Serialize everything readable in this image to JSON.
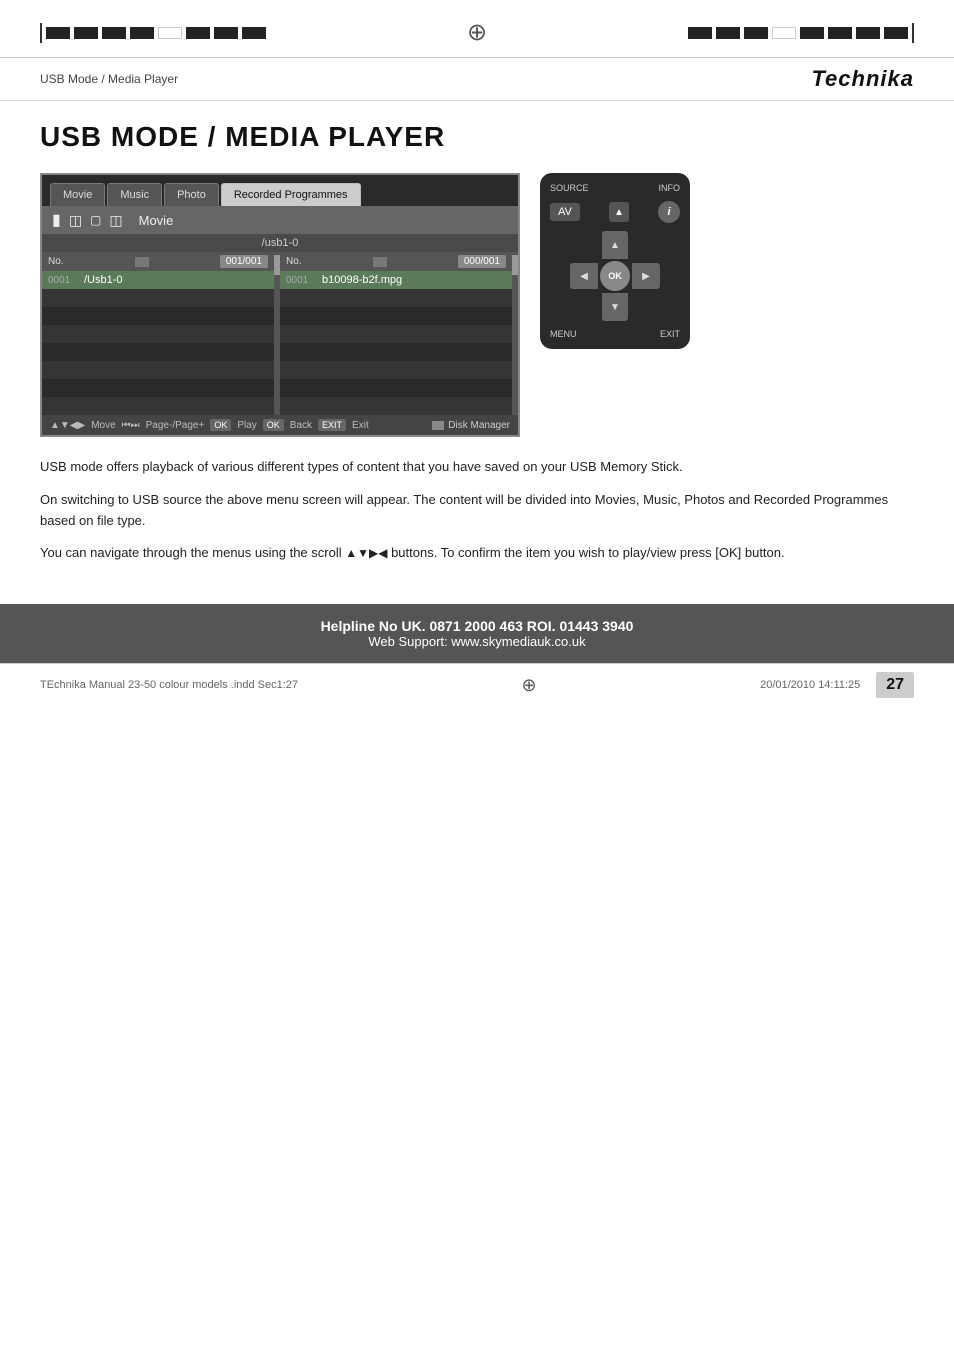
{
  "brand": "Technika",
  "header": {
    "subtitle": "USB Mode / Media Player"
  },
  "page_title": "USB MODE / MEDIA PLAYER",
  "tv_ui": {
    "tabs": [
      "Movie",
      "Music",
      "Photo",
      "Recorded Programmes"
    ],
    "active_tab": "Recorded Programmes",
    "title_bar_text": "Movie",
    "path_bar": "/usb1-0",
    "left_panel": {
      "header_label": "No.",
      "counter": "001/001",
      "items": [
        {
          "num": "0001",
          "name": "/Usb1-0"
        },
        {
          "num": "",
          "name": ""
        },
        {
          "num": "",
          "name": ""
        },
        {
          "num": "",
          "name": ""
        },
        {
          "num": "",
          "name": ""
        },
        {
          "num": "",
          "name": ""
        },
        {
          "num": "",
          "name": ""
        },
        {
          "num": "",
          "name": ""
        }
      ]
    },
    "right_panel": {
      "header_label": "No.",
      "counter": "000/001",
      "items": [
        {
          "num": "0001",
          "name": "b10098-b2f.mpg"
        },
        {
          "num": "",
          "name": ""
        },
        {
          "num": "",
          "name": ""
        },
        {
          "num": "",
          "name": ""
        },
        {
          "num": "",
          "name": ""
        },
        {
          "num": "",
          "name": ""
        },
        {
          "num": "",
          "name": ""
        },
        {
          "num": "",
          "name": ""
        }
      ]
    },
    "bottom_bar": {
      "move_label": "Move",
      "page_label": "Page-/Page+",
      "ok_label": "OK",
      "play_label": "Play",
      "ok2_label": "OK",
      "back_label": "Back",
      "exit_label": "EXIT",
      "exit2_label": "Exit",
      "disk_manager_label": "Disk Manager"
    }
  },
  "remote": {
    "source_label": "SOURCE",
    "info_label": "INFO",
    "av_label": "AV",
    "ok_label": "OK",
    "menu_label": "MENU",
    "exit_label": "EXIT",
    "info_symbol": "i"
  },
  "description": {
    "para1": "USB mode offers playback of various different types of content that you have saved on your USB Memory Stick.",
    "para2": "On switching to USB source the above menu screen will appear. The content will be divided into Movies, Music, Photos and Recorded Programmes based on file type.",
    "para3_prefix": "You can navigate through the menus using the scroll ",
    "para3_arrows": "▲▼▶◀",
    "para3_suffix": " buttons. To confirm the item you wish to play/view press [OK] button."
  },
  "footer": {
    "helpline": "Helpline No UK. 0871 2000 463   ROI. 01443 3940",
    "web": "Web Support: www.skymediauk.co.uk"
  },
  "bottom_bar": {
    "left_text": "TEchnika Manual 23-50 colour models .indd  Sec1:27",
    "right_text": "20/01/2010  14:11:25"
  },
  "page_number": "27"
}
